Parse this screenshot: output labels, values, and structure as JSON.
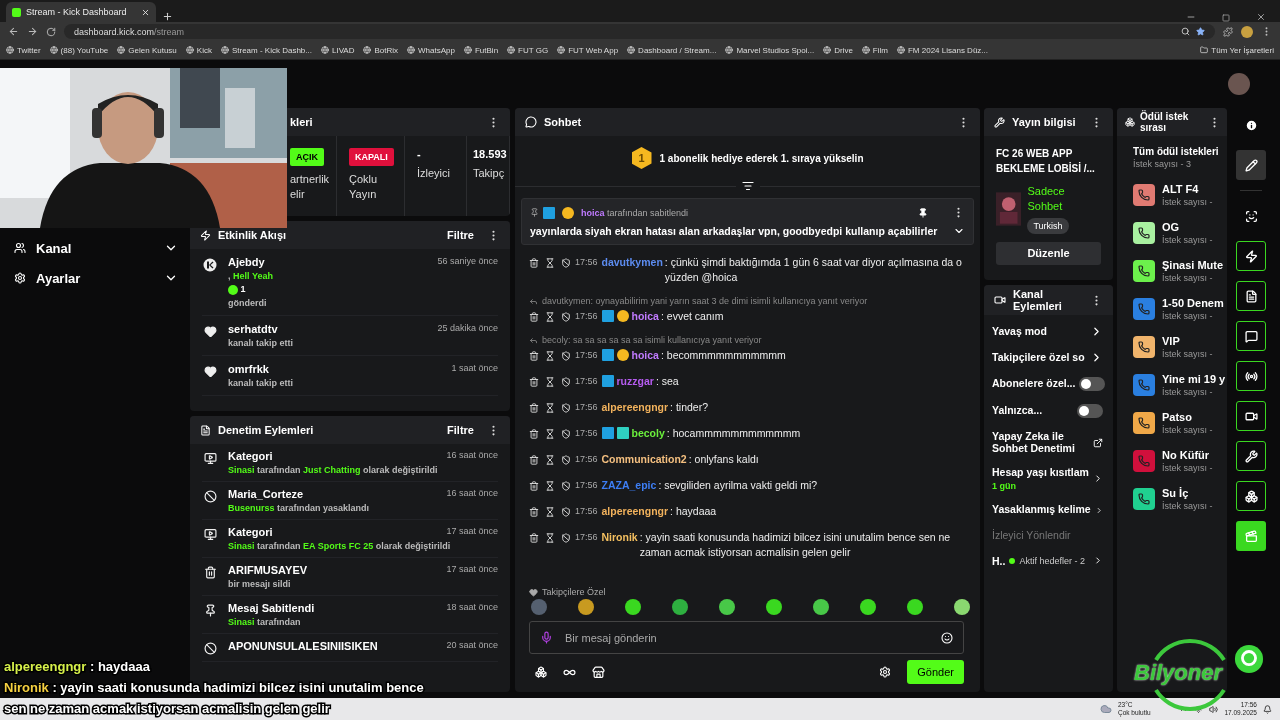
{
  "browser": {
    "tab_title": "Stream - Kick Dashboard",
    "url_host": "dashboard.kick.com",
    "url_path": "/stream",
    "bookmarks": [
      "Twitter",
      "(88) YouTube",
      "Gelen Kutusu",
      "Kick",
      "Stream - Kick Dashb...",
      "LIVAD",
      "BotRix",
      "WhatsApp",
      "FutBin",
      "FUT GG",
      "FUT Web App",
      "Dashboard / Stream...",
      "Marvel Studios Spoi...",
      "Drive",
      "Film",
      "FM 2024 Lisans Düz..."
    ],
    "all_bookmarks": "Tüm Yer İşaretleri"
  },
  "sidebar": {
    "items": [
      {
        "label": "Kanal",
        "expanded": false
      },
      {
        "label": "Ayarlar",
        "expanded": false
      }
    ]
  },
  "stats_panel": {
    "title": "kleri",
    "cells": [
      {
        "kind": "badge",
        "badge": "AÇIK",
        "on": true,
        "label": [
          "artnerlik",
          "elir"
        ]
      },
      {
        "kind": "badge",
        "badge": "KAPALI",
        "on": false,
        "label": [
          "Çoklu",
          "Yayın"
        ]
      },
      {
        "kind": "value",
        "value": "-",
        "label": [
          "İzleyici"
        ]
      },
      {
        "kind": "value",
        "value": "18.593",
        "label": [
          "Takipç"
        ]
      }
    ]
  },
  "activity": {
    "title": "Etkinlik Akışı",
    "filter": "Filtre",
    "items": [
      {
        "kind": "gift",
        "user": "Ajebdy",
        "time": "56 saniye önce",
        "lead": ",",
        "highlight": "Hell Yeah",
        "amount": "1",
        "note": "gönderdi"
      },
      {
        "kind": "follow",
        "user": "serhatdtv",
        "time": "25 dakika önce",
        "note": "kanalı takip etti"
      },
      {
        "kind": "follow",
        "user": "omrfrkk",
        "time": "1 saat önce",
        "note": "kanalı takip etti"
      }
    ]
  },
  "moderation": {
    "title": "Denetim Eylemleri",
    "filter": "Filtre",
    "items": [
      {
        "kind": "category",
        "title": "Kategori",
        "time": "16 saat önce",
        "parts": [
          {
            "text": "Sinasi",
            "hl": true
          },
          {
            "text": "tarafından",
            "hl": false
          },
          {
            "text": "Just Chatting",
            "hl": true
          },
          {
            "text": "olarak değiştirildi",
            "hl": false
          }
        ]
      },
      {
        "kind": "ban",
        "title": "Maria_Corteze",
        "time": "16 saat önce",
        "parts": [
          {
            "text": "Busenurss",
            "hl": true
          },
          {
            "text": "tarafından yasaklandı",
            "hl": false
          }
        ]
      },
      {
        "kind": "category",
        "title": "Kategori",
        "time": "17 saat önce",
        "parts": [
          {
            "text": "Sinasi",
            "hl": true
          },
          {
            "text": "tarafından",
            "hl": false
          },
          {
            "text": "EA Sports FC 25",
            "hl": true
          },
          {
            "text": "olarak değiştirildi",
            "hl": false
          }
        ]
      },
      {
        "kind": "delete",
        "title": "ARIFMUSAYEV",
        "time": "17 saat önce",
        "parts": [
          {
            "text": "bir mesajı sildi",
            "hl": false
          }
        ]
      },
      {
        "kind": "pin",
        "title": "Mesaj Sabitlendi",
        "time": "18 saat önce",
        "parts": [
          {
            "text": "Sinasi",
            "hl": true
          },
          {
            "text": "tarafından",
            "hl": false
          }
        ]
      },
      {
        "kind": "ban",
        "title": "APONUNSULALESINIISIKEN",
        "time": "20 saat önce"
      }
    ]
  },
  "chat": {
    "title": "Sohbet",
    "promo_rank": "1",
    "promo": "1 abonelik hediye ederek 1. sıraya yükselin",
    "pinned": {
      "moderator": true,
      "subscriber": true,
      "user": "hoica",
      "color": "#c07bff",
      "suffix": "tarafından sabitlendi",
      "text": "yayınlarda siyah ekran hatası alan arkadaşlar vpn, goodbyedpi kullanıp açabilirler",
      "expanded": false
    },
    "messages": [
      {
        "time": "17:56",
        "user": "davutkymen",
        "color": "#5c8cf0",
        "moderator": false,
        "subscriber": false,
        "og": false,
        "text": ": çünkü şimdi baktığımda 1 gün 6 saat var diyor açılmasına da o yüzden @hoica"
      },
      {
        "reply": "davutkymen: oynayabilirim yani yarın saat 3 de dimi isimli kullanıcıya yanıt veriyor",
        "time": "17:56",
        "user": "hoica",
        "color": "#c07bff",
        "moderator": true,
        "subscriber": true,
        "og": false,
        "text": ": evvet canım"
      },
      {
        "reply": "becoly: sa sa sa sa sa sa isimli kullanıcıya yanıt veriyor",
        "time": "17:56",
        "user": "hoica",
        "color": "#c07bff",
        "moderator": true,
        "subscriber": true,
        "og": false,
        "text": ": becommmmmmmmmmm"
      },
      {
        "time": "17:56",
        "user": "ruzzgar",
        "color": "#b65cf0",
        "moderator": true,
        "subscriber": false,
        "og": false,
        "text": ": sea"
      },
      {
        "time": "17:56",
        "user": "alpereengngr",
        "color": "#f2b25c",
        "moderator": false,
        "subscriber": false,
        "og": false,
        "text": ": tinder?"
      },
      {
        "time": "17:56",
        "user": "becoly",
        "color": "#6bf03c",
        "moderator": true,
        "subscriber": false,
        "og": true,
        "text": ": hocammmmmmmmmmmm"
      },
      {
        "time": "17:56",
        "user": "Communication2",
        "color": "#f5c080",
        "moderator": false,
        "subscriber": false,
        "og": false,
        "text": ": onlyfans kaldı"
      },
      {
        "time": "17:56",
        "user": "ZAZA_epic",
        "color": "#3d7ef5",
        "moderator": false,
        "subscriber": false,
        "og": false,
        "text": ": sevgiliden ayrilma vakti geldi mi?"
      },
      {
        "time": "17:56",
        "user": "alpereengngr",
        "color": "#f2b25c",
        "moderator": false,
        "subscriber": false,
        "og": false,
        "text": ": haydaaa"
      },
      {
        "time": "17:56",
        "user": "Nironik",
        "color": "#f5c060",
        "moderator": false,
        "subscriber": false,
        "og": false,
        "text": ": yayin saati konusunda hadimizi bilcez isini unutalim bence sen ne zaman acmak istiyorsan acmalisin gelen gelir"
      }
    ],
    "emote_label": "Takipçilere Özel",
    "placeholder": "Bir mesaj gönderin",
    "send": "Gönder"
  },
  "stream_info": {
    "title": "Yayın bilgisi",
    "stream_title": "FC 26 WEB APP BEKLEME LOBİSİ /...",
    "category": "Sadece Sohbet",
    "tag": "Turkish",
    "edit": "Düzenle"
  },
  "channel_actions": {
    "title": "Kanal Eylemleri",
    "items": [
      {
        "kind": "link",
        "label": "Yavaş mod"
      },
      {
        "kind": "link",
        "label": "Takipçilere özel so"
      },
      {
        "kind": "toggle",
        "label": "Abonelere özel...",
        "on": false
      },
      {
        "kind": "toggle",
        "label": "Yalnızca...",
        "on": false
      },
      {
        "kind": "external",
        "label": "Yapay Zeka ile Sohbet Denetimi"
      },
      {
        "kind": "link",
        "label": "Hesap yaşı kısıtlam",
        "sub": "1 gün"
      },
      {
        "kind": "link",
        "label": "Yasaklanmış kelime"
      },
      {
        "kind": "heading",
        "label": "İzleyici Yönlendir"
      },
      {
        "kind": "goal",
        "label": "H..",
        "status": "Aktif hedefler - 2"
      }
    ]
  },
  "rewards": {
    "title": "Ödül istek sırası",
    "all": "Tüm ödül istekleri",
    "all_count": "İstek sayısı - 3",
    "items": [
      {
        "name": "ALT F4",
        "count": "İstek sayısı -",
        "color": "#e07a72"
      },
      {
        "name": "OG",
        "count": "İstek sayısı -",
        "color": "#a8f0a0"
      },
      {
        "name": "Şinasi Mute",
        "count": "İstek sayısı -",
        "color": "#6cf04c"
      },
      {
        "name": "1-50 Denem",
        "count": "İstek sayısı -",
        "color": "#2a7fe0"
      },
      {
        "name": "VIP",
        "count": "İstek sayısı -",
        "color": "#f0b46c"
      },
      {
        "name": "Yine mi 19 y",
        "count": "İstek sayısı -",
        "color": "#2a7fe0"
      },
      {
        "name": "Patso",
        "count": "İstek sayısı -",
        "color": "#f0a848"
      },
      {
        "name": "No Küfür",
        "count": "İstek sayısı -",
        "color": "#d0103c"
      },
      {
        "name": "Su İç",
        "count": "İstek sayısı -",
        "color": "#20d090"
      }
    ]
  },
  "rail": [
    {
      "selected": false
    },
    {
      "selected": true
    },
    {
      "selected": false
    },
    {
      "selected": false
    },
    {
      "selected": false
    },
    {
      "selected": false
    },
    {
      "selected": false
    },
    {
      "selected": false
    },
    {
      "selected": false
    },
    {
      "selected": false
    },
    {
      "selected": false
    }
  ],
  "overlay": {
    "subtitles": [
      {
        "user": "alpereengngr",
        "color": "#d6f04a",
        "text": ": haydaaa"
      },
      {
        "user": "Nironik",
        "color": "#f5d040",
        "text": ": yayin saati konusunda hadimizi bilcez isini unutalim bence"
      },
      {
        "text": "sen ne zaman acmak istiyorsan acmalisin gelen gelir"
      }
    ],
    "logo": "Bilyoner"
  },
  "taskbar": {
    "temperature": "23°C",
    "weather": "Çok bulutlu",
    "time": "17:56",
    "date": "17.09.2025"
  }
}
